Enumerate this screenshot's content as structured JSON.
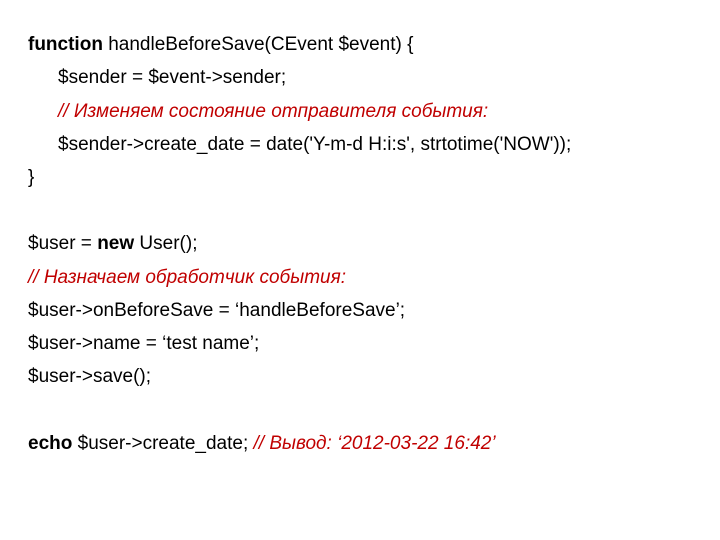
{
  "code": {
    "l1a": "function",
    "l1b": " handleBeforeSave(CEvent $event) {",
    "l2": "$sender = $event->sender;",
    "l3": "// Изменяем состояние отправителя события:",
    "l4": "$sender->create_date = date('Y-m-d H:i:s', strtotime('NOW'));",
    "l5": "}",
    "l6a": "$user = ",
    "l6b": "new",
    "l6c": " User();",
    "l7": "// Назначаем обработчик события:",
    "l8": "$user->onBeforeSave = ‘handleBeforeSave’;",
    "l9": "$user->name = ‘test name’;",
    "l10": "$user->save();",
    "l11a": "echo",
    "l11b": " $user->create_date; ",
    "l11c": "// Вывод: ‘2012-03-22 16:42’"
  }
}
